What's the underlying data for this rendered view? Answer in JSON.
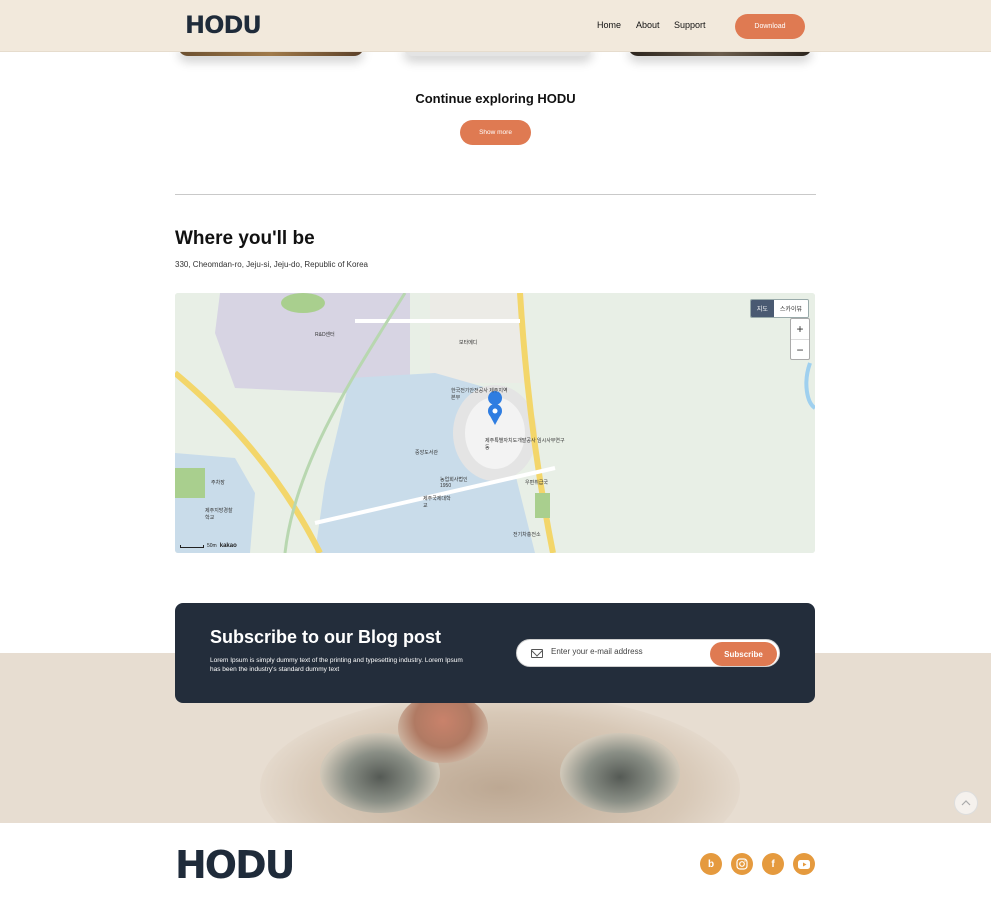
{
  "header": {
    "logo": "HODU",
    "nav": {
      "home": "Home",
      "about": "About",
      "support": "Support"
    },
    "download": "Download"
  },
  "explore": {
    "title": "Continue exploring HODU",
    "show_more": "Show more"
  },
  "location": {
    "title": "Where you'll be",
    "address": "330, Cheomdan-ro, Jeju-si, Jeju-do, Republic of Korea"
  },
  "map": {
    "toggle_map": "지도",
    "toggle_sky": "스카이뷰",
    "zoom_in": "+",
    "zoom_out": "−",
    "scale": "50m",
    "brand": "kakao",
    "labels": {
      "l1": "R&D센터",
      "l2": "보타메디",
      "l3": "한국전기안전공사 제주지역본부",
      "l4": "제주특별자치도개발공사 임시사무연구동",
      "l5": "중앙도서관",
      "l6": "농업회사법인 1950",
      "l7": "제주국제대학교",
      "l8": "우편취급국",
      "l9": "주차장",
      "l10": "제주지방경찰학교",
      "l11": "전기차충전소"
    }
  },
  "subscribe": {
    "title": "Subscribe to our Blog post",
    "description": "Lorem Ipsum is simply dummy text of the printing and typesetting industry. Lorem Ipsum has been the industry's standard dummy text",
    "placeholder": "Enter your e-mail address",
    "button": "Subscribe"
  },
  "footer": {
    "logo": "HODU",
    "social": [
      "b",
      "instagram-icon",
      "f",
      "youtube-icon"
    ]
  },
  "colors": {
    "accent": "#df7a52",
    "dark": "#232d3b",
    "header_bg": "#f2e9dc",
    "social": "#e59a3e"
  }
}
